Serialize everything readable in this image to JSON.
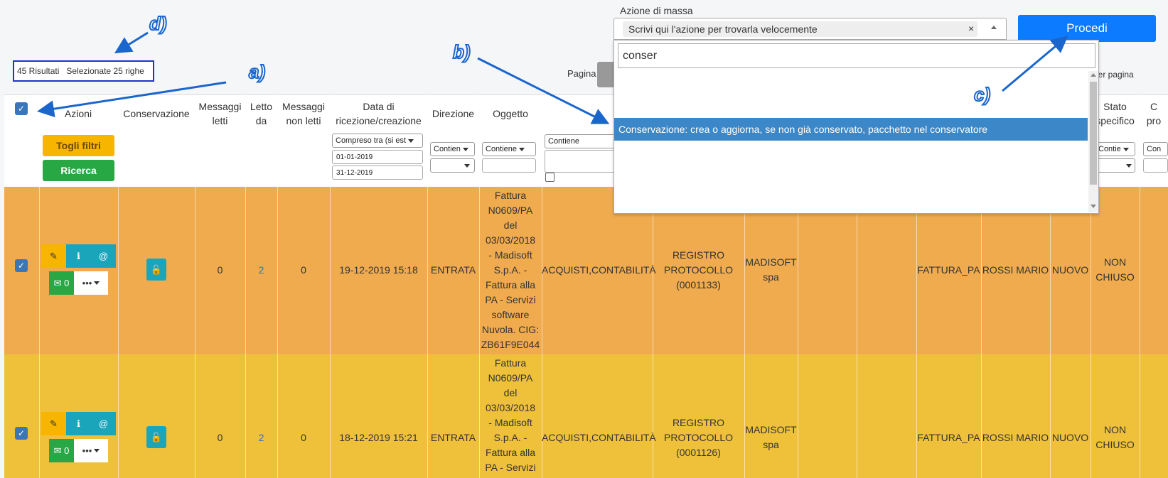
{
  "header": {
    "results_count": "45 Risultati",
    "selected_rows": "Selezionate 25 righe",
    "pagina_label": "Pagina",
    "per_pagina_label": "i per pagina"
  },
  "mass_action": {
    "label": "Azione di massa",
    "selected_text": "Scrivi qui l'azione per trovarla velocemente",
    "clear": "×",
    "search_value": "conser",
    "option": "Conservazione: crea o aggiorna, se non già conservato, pacchetto nel conservatore",
    "proceed_label": "Procedi"
  },
  "annotations": {
    "a": "a)",
    "b": "b)",
    "c": "c)",
    "d": "d)"
  },
  "columns": {
    "azioni": "Azioni",
    "conservazione": "Conservazione",
    "messaggi_letti_1": "Messaggi",
    "messaggi_letti_2": "letti",
    "letto_da_1": "Letto",
    "letto_da_2": "da",
    "non_letti_1": "Messaggi",
    "non_letti_2": "non letti",
    "data_1": "Data di",
    "data_2": "ricezione/creazione",
    "direzione": "Direzione",
    "oggetto": "Oggetto",
    "stato_1": "Stato",
    "stato_2": "specifico",
    "last_1": "C",
    "last_2": "pro"
  },
  "filters": {
    "togli_filtri": "Togli filtri",
    "ricerca": "Ricerca",
    "date_mode": "Compreso tra (si est",
    "date_from": "01-01-2019",
    "date_to": "31-12-2019",
    "contien": "Contien",
    "contiene": "Contiene",
    "contie": "Contie",
    "con": "Con"
  },
  "rows": [
    {
      "unread": "0",
      "messaggi_letti": "0",
      "letto_da": "2",
      "non_letti": "0",
      "data": "19-12-2019 15:18",
      "direzione": "ENTRATA",
      "oggetto": [
        "Fattura",
        "N0609/PA",
        "del",
        "03/03/2018",
        "- Madisoft",
        "S.p.A. -",
        "Fattura alla",
        "PA - Servizi",
        "software",
        "Nuvola. CIG:",
        "ZB61F9E044"
      ],
      "settori": "ACQUISTI,CONTABILITÀ",
      "registro": [
        "REGISTRO",
        "PROTOCOLLO",
        "(0001133)"
      ],
      "mittente": [
        "MADISOFT",
        "spa"
      ],
      "tipo": "FATTURA_PA",
      "assegnatario": "ROSSI MARIO",
      "stato": "NUOVO",
      "stato_specifico": [
        "NON",
        "CHIUSO"
      ]
    },
    {
      "unread": "0",
      "messaggi_letti": "0",
      "letto_da": "2",
      "non_letti": "0",
      "data": "18-12-2019 15:21",
      "direzione": "ENTRATA",
      "oggetto": [
        "Fattura",
        "N0609/PA",
        "del",
        "03/03/2018",
        "- Madisoft",
        "S.p.A. -",
        "Fattura alla",
        "PA - Servizi"
      ],
      "settori": "ACQUISTI,CONTABILITÀ",
      "registro": [
        "REGISTRO",
        "PROTOCOLLO",
        "(0001126)"
      ],
      "mittente": [
        "MADISOFT",
        "spa"
      ],
      "tipo": "FATTURA_PA",
      "assegnatario": "ROSSI MARIO",
      "stato": "NUOVO",
      "stato_specifico": [
        "NON",
        "CHIUSO"
      ]
    }
  ]
}
